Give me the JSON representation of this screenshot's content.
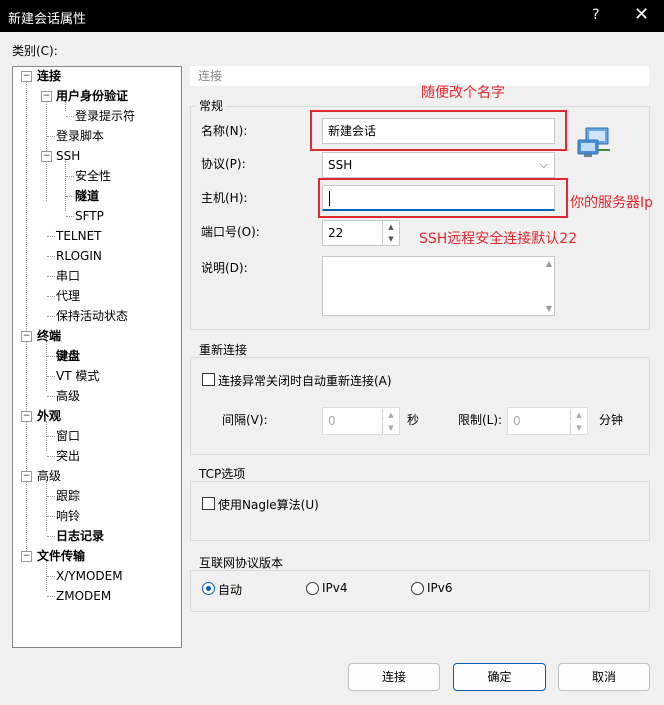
{
  "window": {
    "title": "新建会话属性",
    "help": "?",
    "close": "✕"
  },
  "category_label": "类别(C):",
  "tree": {
    "connect": "连接",
    "user_auth": "用户身份验证",
    "login_prompt": "登录提示符",
    "login_script": "登录脚本",
    "ssh": "SSH",
    "security": "安全性",
    "tunnel": "隧道",
    "sftp": "SFTP",
    "telnet": "TELNET",
    "rlogin": "RLOGIN",
    "serial": "串口",
    "proxy": "代理",
    "keepalive": "保持活动状态",
    "terminal": "终端",
    "keyboard": "键盘",
    "vt_mode": "VT 模式",
    "advanced": "高级",
    "appearance": "外观",
    "window": "窗口",
    "highlight": "突出",
    "advanced2": "高级",
    "trace": "跟踪",
    "bell": "响铃",
    "logging": "日志记录",
    "file_transfer": "文件传输",
    "xymodem": "X/YMODEM",
    "zmodem": "ZMODEM"
  },
  "breadcrumb": "连接",
  "general": {
    "title": "常规",
    "name_label": "名称(N):",
    "name_value": "新建会话",
    "protocol_label": "协议(P):",
    "protocol_value": "SSH",
    "host_label": "主机(H):",
    "host_value": "",
    "port_label": "端口号(O):",
    "port_value": "22",
    "desc_label": "说明(D):",
    "desc_value": ""
  },
  "reconnect": {
    "title": "重新连接",
    "auto_label": "连接异常关闭时自动重新连接(A)",
    "interval_label": "间隔(V):",
    "interval_value": "0",
    "seconds": "秒",
    "limit_label": "限制(L):",
    "limit_value": "0",
    "minutes": "分钟"
  },
  "tcp": {
    "title": "TCP选项",
    "nagle_label": "使用Nagle算法(U)"
  },
  "ipver": {
    "title": "互联网协议版本",
    "auto": "自动",
    "ipv4": "IPv4",
    "ipv6": "IPv6"
  },
  "buttons": {
    "connect": "连接",
    "ok": "确定",
    "cancel": "取消"
  },
  "annotations": {
    "name_note": "随便改个名字",
    "host_note": "你的服务器Ip",
    "port_note": "SSH远程安全连接默认22"
  },
  "colors": {
    "annotation": "#e0282e",
    "accent": "#005fb8"
  }
}
